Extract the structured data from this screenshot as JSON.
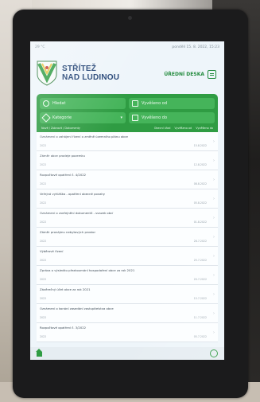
{
  "status": {
    "temperature": "29 °C",
    "datetime": "pondělí 15. 8. 2022, 15:23"
  },
  "brand": {
    "line1": "STŘÍTEŽ",
    "line2": "NAD LUDINOU",
    "board_label": "ÚŘEDNÍ DESKA"
  },
  "filters": {
    "search": "Hledat",
    "category": "Kategorie",
    "published_from": "Vyvěšeno od",
    "published_to": "Vyvěšeno do",
    "tab_current": "Nové / Zobrazit / Dokumenty",
    "links": [
      "Obecní úřad",
      "Vyvěšeno od",
      "Vyvěšeno do"
    ]
  },
  "items": [
    {
      "title": "Oznámení o zahájení řízení o změně územního plánu obce",
      "meta": "2022",
      "date": "15.8.2022"
    },
    {
      "title": "Záměr obce prodeje pozemku",
      "meta": "2022",
      "date": "12.8.2022"
    },
    {
      "title": "Rozpočtové opatření č. 4/2022",
      "meta": "2022",
      "date": "08.8.2022"
    },
    {
      "title": "Veřejná vyhláška - opatření obecné povahy",
      "meta": "2022",
      "date": "05.8.2022"
    },
    {
      "title": "Oznámení o zveřejnění dokumentů - svazek obcí",
      "meta": "2022",
      "date": "01.8.2022"
    },
    {
      "title": "Záměr pronájmu nebytových prostor",
      "meta": "2022",
      "date": "28.7.2022"
    },
    {
      "title": "Výběrové řízení",
      "meta": "2022",
      "date": "25.7.2022"
    },
    {
      "title": "Zpráva o výsledku přezkoumání hospodaření obce za rok 2021",
      "meta": "2022",
      "date": "20.7.2022"
    },
    {
      "title": "Závěrečný účet obce za rok 2021",
      "meta": "2022",
      "date": "15.7.2022"
    },
    {
      "title": "Oznámení o konání zasedání zastupitelstva obce",
      "meta": "2022",
      "date": "11.7.2022"
    },
    {
      "title": "Rozpočtové opatření č. 3/2022",
      "meta": "2022",
      "date": "05.7.2022"
    }
  ],
  "colors": {
    "accent_green": "#2a9a3f",
    "title_blue": "#1d3f73"
  },
  "icons": {
    "home": "home-icon",
    "accessibility": "accessibility-icon"
  }
}
